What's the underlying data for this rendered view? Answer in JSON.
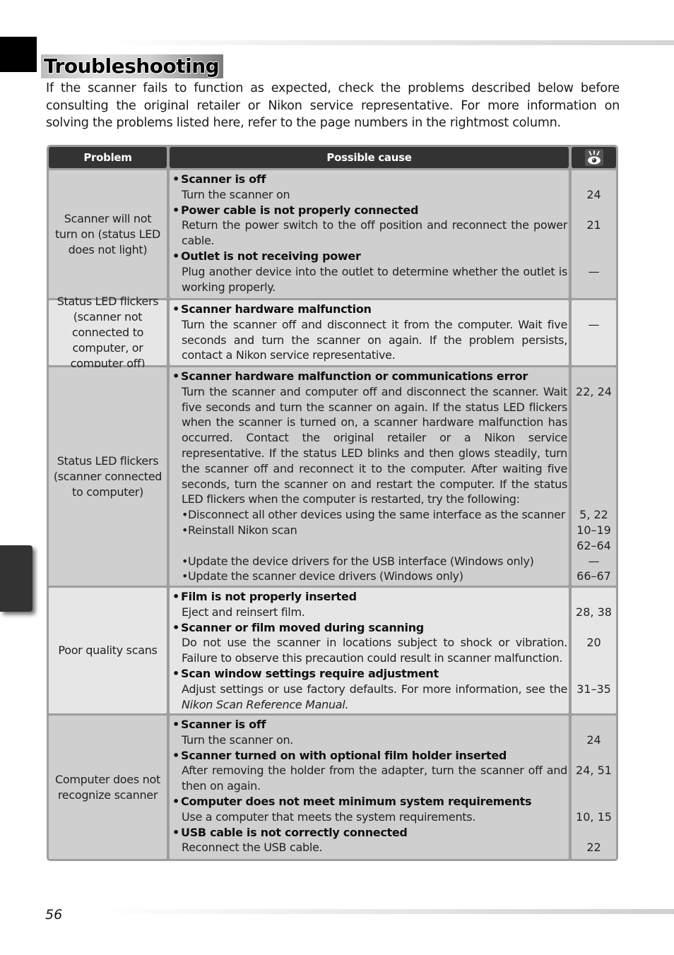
{
  "title": "Troubleshooting",
  "intro": "If the scanner fails to function as expected, check the problems described below before consulting the original retailer or Nikon service representative.  For more information on solving the problems listed here, refer to the page numbers in the rightmost column.",
  "table": {
    "headers": {
      "problem": "Problem",
      "cause": "Possible cause",
      "reference_icon": "eye-reference-icon"
    },
    "rows": [
      {
        "problem": "Scanner will not turn on (status LED does not light)",
        "shade": "dark",
        "causes": [
          {
            "heading": "Scanner is off",
            "detail": "Turn the scanner on"
          },
          {
            "heading": "Power cable is not properly connected",
            "detail": "Return the power switch to the off position and reconnect the power cable."
          },
          {
            "heading": "Outlet is not receiving power",
            "detail": "Plug another device into the outlet to determine whether the outlet is working properly."
          }
        ],
        "pages": [
          "",
          "24",
          "",
          "21",
          "",
          "",
          "—",
          ""
        ]
      },
      {
        "problem": "Status LED flickers (scanner not connected to computer, or computer off)",
        "shade": "light",
        "causes": [
          {
            "heading": "Scanner hardware malfunction",
            "detail": "Turn the scanner off and disconnect it from the computer.  Wait five seconds and turn the scanner on again.  If the problem persists, contact a Nikon service representative."
          }
        ],
        "pages": [
          "",
          "—"
        ]
      },
      {
        "problem": "Status LED flickers (scanner connected to computer)",
        "shade": "dark",
        "causes": [
          {
            "heading": "Scanner hardware malfunction or communications error",
            "detail": "Turn the scanner and computer off and disconnect the scanner.  Wait five seconds and turn the scanner on again.  If the status LED flickers when the scanner is turned on, a scanner hardware malfunction has occurred.  Contact the original retailer or a Nikon service representative.  If the status LED blinks and then glows steadily, turn the scanner off and reconnect it to the computer.  After waiting five seconds, turn the scanner on and restart the computer.  If the status LED flickers when the computer is restarted, try the following:"
          }
        ],
        "sub_items": [
          "Disconnect all other devices using the same interface as the scanner",
          "Reinstall Nikon scan",
          "",
          "Update the device drivers for the USB interface (Windows only)",
          "Update the scanner device drivers (Windows only)"
        ],
        "pages": [
          "",
          "22, 24",
          "",
          "",
          "",
          "",
          "",
          "",
          "",
          "5, 22",
          "10–19",
          "62–64",
          "—",
          "66–67"
        ]
      },
      {
        "problem": "Poor quality scans",
        "shade": "light",
        "causes": [
          {
            "heading": "Film is not properly inserted",
            "detail": "Eject and reinsert film."
          },
          {
            "heading": "Scanner or film moved during scanning",
            "detail": "Do not use the scanner in locations subject to shock or vibration.  Failure to observe this precaution could result in scanner malfunction."
          },
          {
            "heading": "Scan window settings require adjustment",
            "detail": "Adjust settings or use factory defaults.  For more information, see the ",
            "detail_italic": "Nikon Scan Reference Manual."
          }
        ],
        "pages": [
          "",
          "28, 38",
          "",
          "20",
          "",
          "",
          "31–35",
          ""
        ]
      },
      {
        "problem": "Computer does not recognize scanner",
        "shade": "dark",
        "causes": [
          {
            "heading": "Scanner is off",
            "detail": "Turn the scanner on."
          },
          {
            "heading": "Scanner turned on with optional film holder inserted",
            "detail": "After removing the holder from the adapter, turn the scanner off and then on again."
          },
          {
            "heading": "Computer does not meet minimum system requirements",
            "detail": "Use a computer that meets the system requirements."
          },
          {
            "heading": "USB cable is not correctly connected",
            "detail": "Reconnect the USB cable."
          }
        ],
        "pages": [
          "",
          "24",
          "",
          "24, 51",
          "",
          "",
          "10, 15",
          "",
          "22"
        ]
      }
    ]
  },
  "page_number": "56"
}
